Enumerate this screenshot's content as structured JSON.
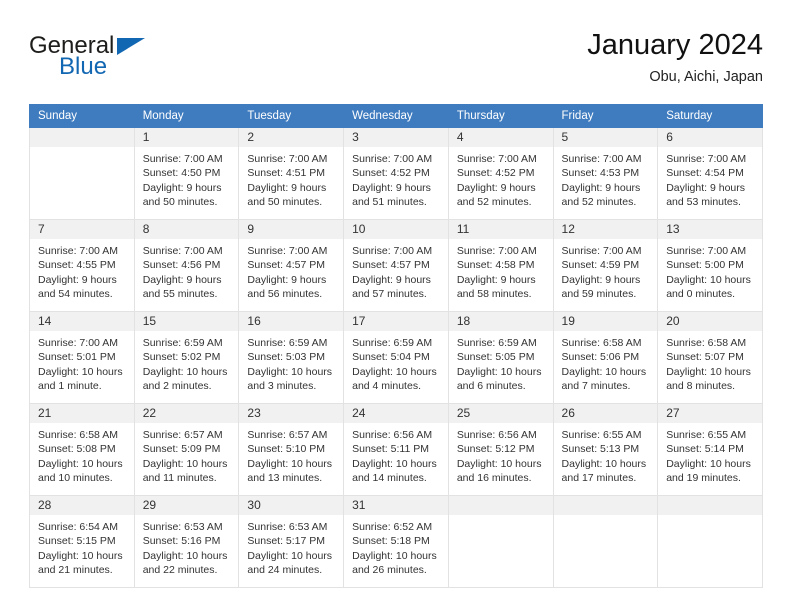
{
  "brand": {
    "name_dark": "General",
    "name_blue": "Blue",
    "triangle_icon": "brand-triangle-icon",
    "accent_color": "#1267b2"
  },
  "header": {
    "title": "January 2024",
    "subtitle": "Obu, Aichi, Japan"
  },
  "colors": {
    "header_blue": "#3f7cbf",
    "daynum_band": "#f1f1f1",
    "grid_line": "#e2e2e2"
  },
  "weekdays": [
    "Sunday",
    "Monday",
    "Tuesday",
    "Wednesday",
    "Thursday",
    "Friday",
    "Saturday"
  ],
  "weeks": [
    [
      {
        "day": ""
      },
      {
        "day": "1",
        "sunrise": "Sunrise: 7:00 AM",
        "sunset": "Sunset: 4:50 PM",
        "daylight": "Daylight: 9 hours and 50 minutes."
      },
      {
        "day": "2",
        "sunrise": "Sunrise: 7:00 AM",
        "sunset": "Sunset: 4:51 PM",
        "daylight": "Daylight: 9 hours and 50 minutes."
      },
      {
        "day": "3",
        "sunrise": "Sunrise: 7:00 AM",
        "sunset": "Sunset: 4:52 PM",
        "daylight": "Daylight: 9 hours and 51 minutes."
      },
      {
        "day": "4",
        "sunrise": "Sunrise: 7:00 AM",
        "sunset": "Sunset: 4:52 PM",
        "daylight": "Daylight: 9 hours and 52 minutes."
      },
      {
        "day": "5",
        "sunrise": "Sunrise: 7:00 AM",
        "sunset": "Sunset: 4:53 PM",
        "daylight": "Daylight: 9 hours and 52 minutes."
      },
      {
        "day": "6",
        "sunrise": "Sunrise: 7:00 AM",
        "sunset": "Sunset: 4:54 PM",
        "daylight": "Daylight: 9 hours and 53 minutes."
      }
    ],
    [
      {
        "day": "7",
        "sunrise": "Sunrise: 7:00 AM",
        "sunset": "Sunset: 4:55 PM",
        "daylight": "Daylight: 9 hours and 54 minutes."
      },
      {
        "day": "8",
        "sunrise": "Sunrise: 7:00 AM",
        "sunset": "Sunset: 4:56 PM",
        "daylight": "Daylight: 9 hours and 55 minutes."
      },
      {
        "day": "9",
        "sunrise": "Sunrise: 7:00 AM",
        "sunset": "Sunset: 4:57 PM",
        "daylight": "Daylight: 9 hours and 56 minutes."
      },
      {
        "day": "10",
        "sunrise": "Sunrise: 7:00 AM",
        "sunset": "Sunset: 4:57 PM",
        "daylight": "Daylight: 9 hours and 57 minutes."
      },
      {
        "day": "11",
        "sunrise": "Sunrise: 7:00 AM",
        "sunset": "Sunset: 4:58 PM",
        "daylight": "Daylight: 9 hours and 58 minutes."
      },
      {
        "day": "12",
        "sunrise": "Sunrise: 7:00 AM",
        "sunset": "Sunset: 4:59 PM",
        "daylight": "Daylight: 9 hours and 59 minutes."
      },
      {
        "day": "13",
        "sunrise": "Sunrise: 7:00 AM",
        "sunset": "Sunset: 5:00 PM",
        "daylight": "Daylight: 10 hours and 0 minutes."
      }
    ],
    [
      {
        "day": "14",
        "sunrise": "Sunrise: 7:00 AM",
        "sunset": "Sunset: 5:01 PM",
        "daylight": "Daylight: 10 hours and 1 minute."
      },
      {
        "day": "15",
        "sunrise": "Sunrise: 6:59 AM",
        "sunset": "Sunset: 5:02 PM",
        "daylight": "Daylight: 10 hours and 2 minutes."
      },
      {
        "day": "16",
        "sunrise": "Sunrise: 6:59 AM",
        "sunset": "Sunset: 5:03 PM",
        "daylight": "Daylight: 10 hours and 3 minutes."
      },
      {
        "day": "17",
        "sunrise": "Sunrise: 6:59 AM",
        "sunset": "Sunset: 5:04 PM",
        "daylight": "Daylight: 10 hours and 4 minutes."
      },
      {
        "day": "18",
        "sunrise": "Sunrise: 6:59 AM",
        "sunset": "Sunset: 5:05 PM",
        "daylight": "Daylight: 10 hours and 6 minutes."
      },
      {
        "day": "19",
        "sunrise": "Sunrise: 6:58 AM",
        "sunset": "Sunset: 5:06 PM",
        "daylight": "Daylight: 10 hours and 7 minutes."
      },
      {
        "day": "20",
        "sunrise": "Sunrise: 6:58 AM",
        "sunset": "Sunset: 5:07 PM",
        "daylight": "Daylight: 10 hours and 8 minutes."
      }
    ],
    [
      {
        "day": "21",
        "sunrise": "Sunrise: 6:58 AM",
        "sunset": "Sunset: 5:08 PM",
        "daylight": "Daylight: 10 hours and 10 minutes."
      },
      {
        "day": "22",
        "sunrise": "Sunrise: 6:57 AM",
        "sunset": "Sunset: 5:09 PM",
        "daylight": "Daylight: 10 hours and 11 minutes."
      },
      {
        "day": "23",
        "sunrise": "Sunrise: 6:57 AM",
        "sunset": "Sunset: 5:10 PM",
        "daylight": "Daylight: 10 hours and 13 minutes."
      },
      {
        "day": "24",
        "sunrise": "Sunrise: 6:56 AM",
        "sunset": "Sunset: 5:11 PM",
        "daylight": "Daylight: 10 hours and 14 minutes."
      },
      {
        "day": "25",
        "sunrise": "Sunrise: 6:56 AM",
        "sunset": "Sunset: 5:12 PM",
        "daylight": "Daylight: 10 hours and 16 minutes."
      },
      {
        "day": "26",
        "sunrise": "Sunrise: 6:55 AM",
        "sunset": "Sunset: 5:13 PM",
        "daylight": "Daylight: 10 hours and 17 minutes."
      },
      {
        "day": "27",
        "sunrise": "Sunrise: 6:55 AM",
        "sunset": "Sunset: 5:14 PM",
        "daylight": "Daylight: 10 hours and 19 minutes."
      }
    ],
    [
      {
        "day": "28",
        "sunrise": "Sunrise: 6:54 AM",
        "sunset": "Sunset: 5:15 PM",
        "daylight": "Daylight: 10 hours and 21 minutes."
      },
      {
        "day": "29",
        "sunrise": "Sunrise: 6:53 AM",
        "sunset": "Sunset: 5:16 PM",
        "daylight": "Daylight: 10 hours and 22 minutes."
      },
      {
        "day": "30",
        "sunrise": "Sunrise: 6:53 AM",
        "sunset": "Sunset: 5:17 PM",
        "daylight": "Daylight: 10 hours and 24 minutes."
      },
      {
        "day": "31",
        "sunrise": "Sunrise: 6:52 AM",
        "sunset": "Sunset: 5:18 PM",
        "daylight": "Daylight: 10 hours and 26 minutes."
      },
      {
        "day": ""
      },
      {
        "day": ""
      },
      {
        "day": ""
      }
    ]
  ]
}
